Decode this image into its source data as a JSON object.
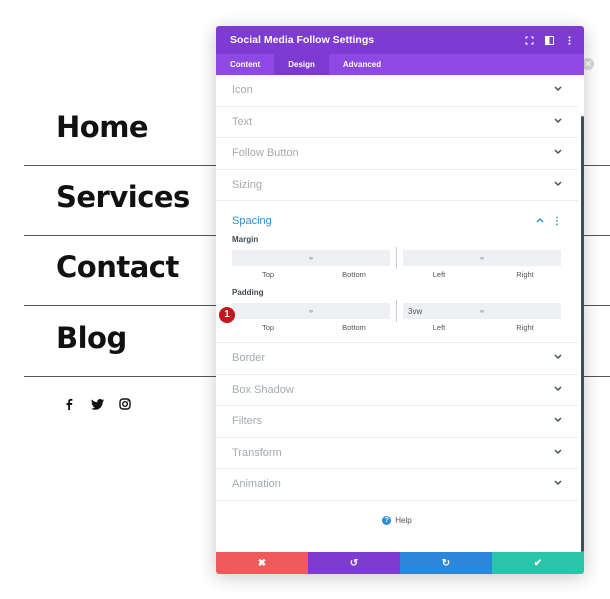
{
  "menu": {
    "items": [
      "Home",
      "Services",
      "Contact",
      "Blog"
    ]
  },
  "social": {
    "icons": [
      "facebook-icon",
      "twitter-icon",
      "instagram-icon"
    ]
  },
  "modal": {
    "title": "Social Media Follow Settings",
    "tabs": [
      "Content",
      "Design",
      "Advanced"
    ],
    "active_tab": "Design",
    "sections_top": [
      "Icon",
      "Text",
      "Follow Button",
      "Sizing"
    ],
    "spacing": {
      "title": "Spacing",
      "margin_label": "Margin",
      "padding_label": "Padding",
      "field_labels": [
        "Top",
        "Bottom",
        "Left",
        "Right"
      ],
      "margin_values": [
        "",
        "",
        "",
        ""
      ],
      "padding_values": [
        "",
        "",
        "3vw",
        ""
      ],
      "badge": "1"
    },
    "sections_bottom": [
      "Border",
      "Box Shadow",
      "Filters",
      "Transform",
      "Animation"
    ],
    "help_label": "Help",
    "footer": {
      "cancel": "✖",
      "undo": "↺",
      "redo": "↻",
      "save": "✔"
    }
  },
  "colors": {
    "header": "#7d3bd4",
    "tabs": "#8e48e3",
    "accent": "#2d8cd2",
    "cancel": "#ef5a5a",
    "undo": "#7e3bd0",
    "redo": "#2b87da",
    "save": "#29c4a9"
  }
}
